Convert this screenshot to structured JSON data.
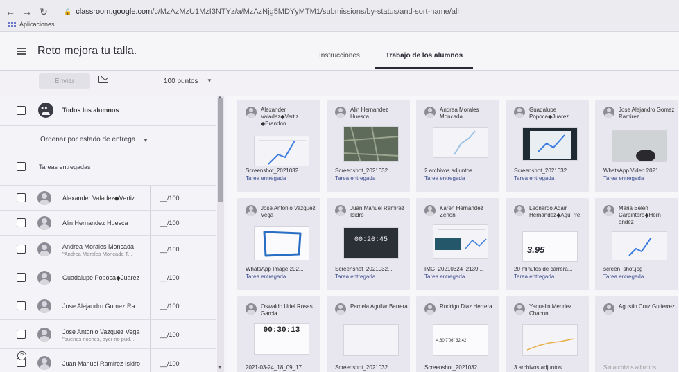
{
  "browser": {
    "nav_icons": [
      "back-icon",
      "forward-icon",
      "reload-icon"
    ],
    "url_host": "classroom.google.com",
    "url_path": "/c/MzAzMzU1MzI3NTYz/a/MzAzNjg5MDYyMTM1/submissions/by-status/and-sort-name/all",
    "bookmark_apps": "Aplicaciones"
  },
  "header": {
    "title": "Reto mejora tu talla.",
    "tab_instructions": "Instrucciones",
    "tab_student_work": "Trabajo de los alumnos"
  },
  "toolbar": {
    "send_label": "Enviar",
    "points": "100 puntos"
  },
  "left_panel": {
    "all_students": "Todos los alumnos",
    "sort_by": "Ordenar por estado de entrega",
    "section_turned_in": "Tareas entregadas",
    "students": [
      {
        "name": "Alexander Valadez◆Vertiz...",
        "sub": "",
        "grade": "__/100"
      },
      {
        "name": "Alin Hernandez Huesca",
        "sub": "",
        "grade": "__/100"
      },
      {
        "name": "Andrea Morales Moncada",
        "sub": "\"Andrea Morales Moncada T...",
        "grade": "__/100"
      },
      {
        "name": "Guadalupe Popoca◆Juarez",
        "sub": "",
        "grade": "__/100"
      },
      {
        "name": "Jose Alejandro Gomez Ra...",
        "sub": "",
        "grade": "__/100"
      },
      {
        "name": "Jose Antonio Vazquez Vega",
        "sub": "\"buenas noches, ayer no pud...",
        "grade": "__/100"
      },
      {
        "name": "Juan Manuel Ramirez Isidro",
        "sub": "",
        "grade": "__/100"
      }
    ]
  },
  "cards": [
    {
      "name": "Alexander Valadez◆Vertiz ◆Brandon",
      "file": "Screenshot_2021032...",
      "status": "Tarea entregada"
    },
    {
      "name": "Alin Hernandez Huesca",
      "file": "Screenshot_2021032...",
      "status": "Tarea entregada"
    },
    {
      "name": "Andrea Morales Moncada",
      "file": "2 archivos adjuntos",
      "status": "Tarea entregada"
    },
    {
      "name": "Guadalupe Popoca◆Juarez",
      "file": "Screenshot_2021032...",
      "status": "Tarea entregada"
    },
    {
      "name": "Jose Alejandro Gomez Ramirez",
      "file": "WhatsApp Video 2021...",
      "status": "Tarea entregada"
    },
    {
      "name": "Jose Antonio Vazquez Vega",
      "file": "WhatsApp Image 202...",
      "status": "Tarea entregada"
    },
    {
      "name": "Juan Manuel Ramirez Isidro",
      "file": "Screenshot_2021032...",
      "status": "Tarea entregada",
      "thumb_text": "00:20:45"
    },
    {
      "name": "Karen Hernandez Zenon",
      "file": "IMG_20210324_2139...",
      "status": "Tarea entregada"
    },
    {
      "name": "Leonardo Adair Hernandez◆Agui rre",
      "file": "20 minutos de carrera...",
      "status": "Tarea entregada",
      "thumb_text": "3.95"
    },
    {
      "name": "Maria Belen Carpintero◆Hern andez",
      "file": "screen_shot.jpg",
      "status": "Tarea entregada"
    },
    {
      "name": "Oswaldo Uriel Rosas Garcia",
      "file": "2021-03-24_18_09_17...",
      "status": "",
      "thumb_text": "00:30:13"
    },
    {
      "name": "Pamela Aguilar Barrera",
      "file": "Screenshot_2021032...",
      "status": ""
    },
    {
      "name": "Rodrigo Diaz Herrera",
      "file": "Screenshot_2021032...",
      "status": "",
      "thumb_text": "4.60  7'06\"  32:42"
    },
    {
      "name": "Yaquelin Mendez Chacon",
      "file": "3 archivos adjuntos",
      "status": ""
    },
    {
      "name": "Agustin Cruz Gutierrez",
      "file": "Sin archivos adjuntos",
      "status": ""
    }
  ]
}
